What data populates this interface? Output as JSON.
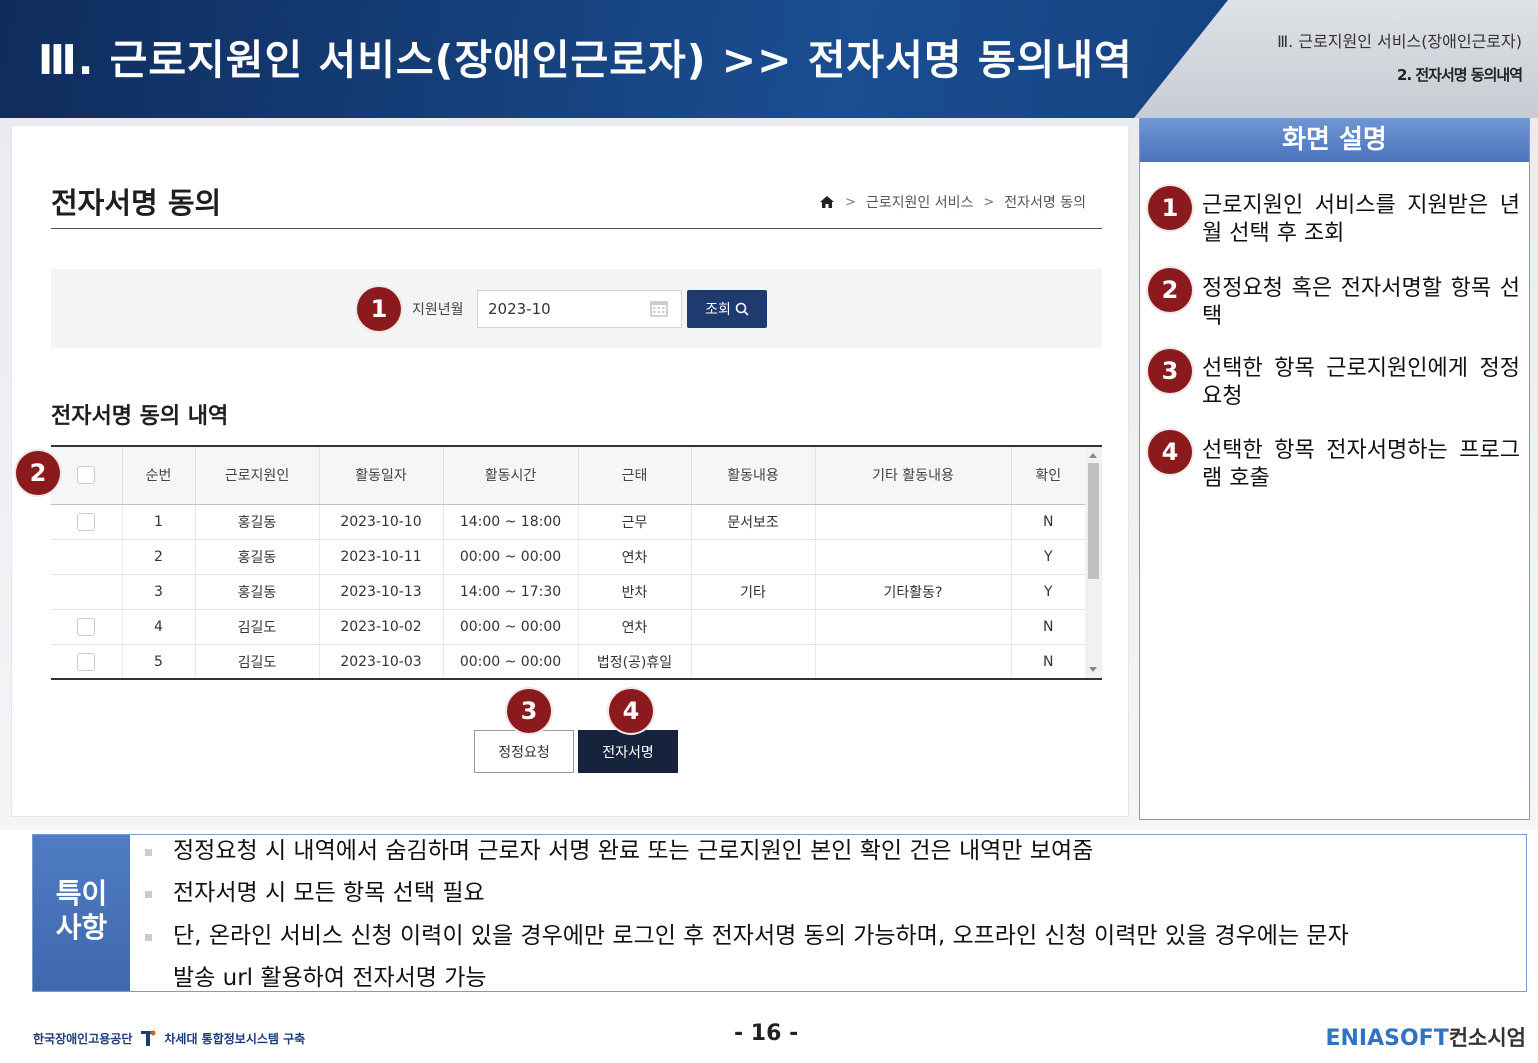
{
  "header": {
    "title": "Ⅲ. 근로지원인 서비스(장애인근로자) >> 전자서명 동의내역",
    "sub_section": "Ⅲ. 근로지원인 서비스(장애인근로자)",
    "sub_page": "2. 전자서명 동의내역"
  },
  "page": {
    "title": "전자서명 동의",
    "breadcrumb": [
      "근로지원인 서비스",
      "전자서명 동의"
    ],
    "breadcrumb_sep": ">"
  },
  "search": {
    "label": "지원년월",
    "value": "2023-10",
    "button_label": "조회"
  },
  "list": {
    "title": "전자서명 동의 내역",
    "columns": [
      "순번",
      "근로지원인",
      "활동일자",
      "활동시간",
      "근태",
      "활동내용",
      "기타 활동내용",
      "확인"
    ],
    "rows": [
      {
        "checkbox": true,
        "no": "1",
        "worker": "홍길동",
        "date": "2023-10-10",
        "time": "14:00 ~ 18:00",
        "attendance": "근무",
        "activity": "문서보조",
        "other": "",
        "confirm": "N"
      },
      {
        "checkbox": false,
        "no": "2",
        "worker": "홍길동",
        "date": "2023-10-11",
        "time": "00:00 ~ 00:00",
        "attendance": "연차",
        "activity": "",
        "other": "",
        "confirm": "Y"
      },
      {
        "checkbox": false,
        "no": "3",
        "worker": "홍길동",
        "date": "2023-10-13",
        "time": "14:00 ~ 17:30",
        "attendance": "반차",
        "activity": "기타",
        "other": "기타활동?",
        "confirm": "Y"
      },
      {
        "checkbox": true,
        "no": "4",
        "worker": "김길도",
        "date": "2023-10-02",
        "time": "00:00 ~ 00:00",
        "attendance": "연차",
        "activity": "",
        "other": "",
        "confirm": "N"
      },
      {
        "checkbox": true,
        "no": "5",
        "worker": "김길도",
        "date": "2023-10-03",
        "time": "00:00 ~ 00:00",
        "attendance": "법정(공)휴일",
        "activity": "",
        "other": "",
        "confirm": "N"
      }
    ]
  },
  "buttons": {
    "fix_request": "정정요청",
    "e_sign": "전자서명"
  },
  "badges": [
    "1",
    "2",
    "3",
    "4"
  ],
  "panel": {
    "title": "화면 설명",
    "items": [
      {
        "num": "1",
        "text": "근로지원인 서비스를 지원받은 년월 선택 후 조회"
      },
      {
        "num": "2",
        "text": "정정요청 혹은 전자서명할 항목 선택"
      },
      {
        "num": "3",
        "text": "선택한 항목 근로지원인에게 정정요청"
      },
      {
        "num": "4",
        "text": "선택한 항목 전자서명하는 프로그램 호출"
      }
    ]
  },
  "notes": {
    "label_line1": "특이",
    "label_line2": "사항",
    "items": [
      "정정요청 시 내역에서 숨김하며 근로자 서명 완료 또는 근로지원인 본인 확인 건은 내역만 보여줌",
      "전자서명 시 모든 항목 선택 필요",
      "단, 온라인 서비스 신청 이력이 있을 경우에만 로그인 후 전자서명 동의 가능하며, 오프라인 신청 이력만 있을 경우에는 문자",
      "발송 url 활용하여 전자서명 가능"
    ]
  },
  "footer": {
    "org": "한국장애인고용공단",
    "project": "차세대 통합정보시스템 구축",
    "page_num": "- 16 -",
    "brand_part1": "EN",
    "brand_part2": "IASOFT",
    "brand_suffix": "컨소시엄"
  },
  "colors": {
    "header_blue": "#1a4e91",
    "badge": "#8b1a1e",
    "primary_button": "#1e3a6e",
    "sign_button": "#16233d",
    "panel_blue": "#4a74bd"
  }
}
